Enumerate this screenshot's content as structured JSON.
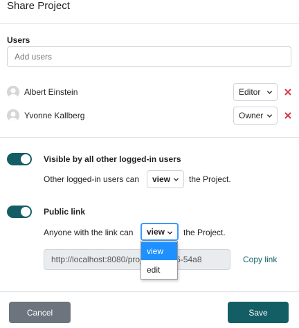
{
  "dialog": {
    "title": "Share Project"
  },
  "users": {
    "label": "Users",
    "placeholder": "Add users",
    "list": [
      {
        "name": "Albert Einstein",
        "role": "Editor"
      },
      {
        "name": "Yvonne Kallberg",
        "role": "Owner"
      }
    ]
  },
  "visibility": {
    "label": "Visible by all other logged-in users",
    "sentence_before": "Other logged-in users can",
    "permission": "view",
    "sentence_after": "the Project.",
    "enabled": true
  },
  "public_link": {
    "label": "Public link",
    "sentence_before": "Anyone with the link can",
    "permission": "view",
    "sentence_after": "the Project.",
    "enabled": true,
    "url": "http://localhost:8080/project/4f43e6-54a8",
    "copy_label": "Copy link",
    "options": [
      "view",
      "edit"
    ],
    "selected_option": "view"
  },
  "footer": {
    "cancel_label": "Cancel",
    "save_label": "Save"
  },
  "colors": {
    "accent": "#135e64",
    "remove": "#dc3545",
    "option_highlight": "#1e90ff",
    "cancel": "#6c757d"
  }
}
